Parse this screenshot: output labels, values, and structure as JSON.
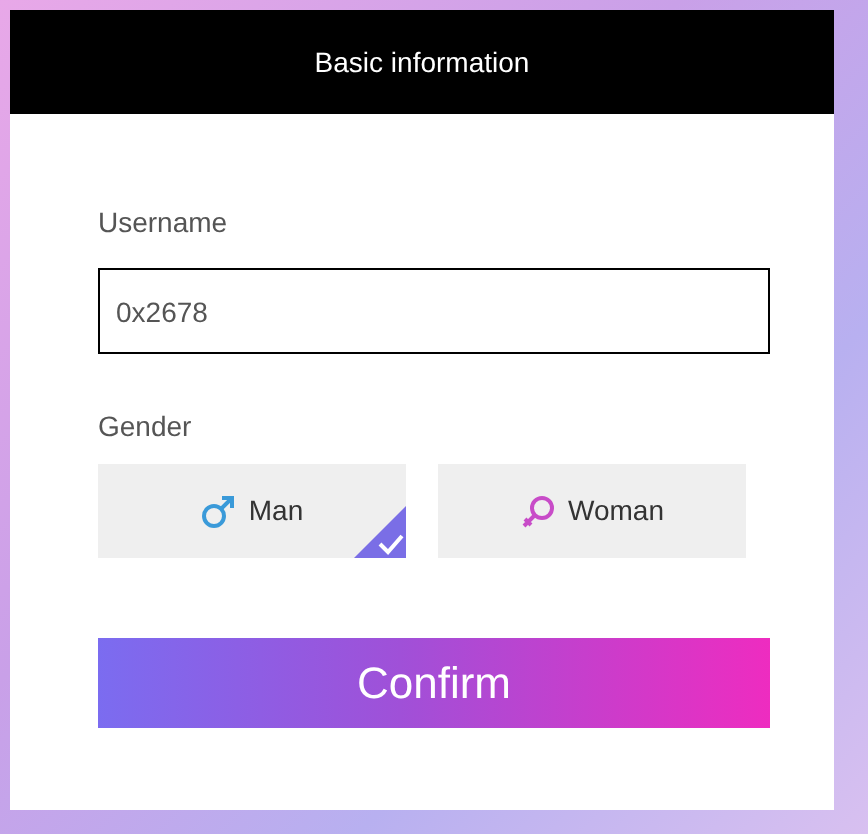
{
  "dialog": {
    "title": "Basic information"
  },
  "username": {
    "label": "Username",
    "value": "0x2678"
  },
  "gender": {
    "label": "Gender",
    "options": [
      {
        "kind": "male",
        "label": "Man",
        "selected": true
      },
      {
        "kind": "female",
        "label": "Woman",
        "selected": false
      }
    ]
  },
  "confirm_button": "Confirm"
}
